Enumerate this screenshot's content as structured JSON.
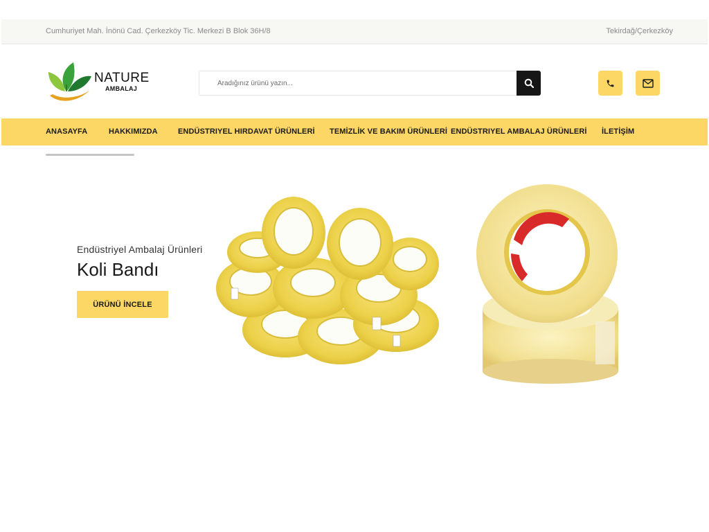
{
  "topbar": {
    "address": "Cumhuriyet Mah. İnönü Cad. Çerkezköy Tic. Merkezi B Blok 36H/8",
    "location": "Tekirdağ/Çerkezköy"
  },
  "logo": {
    "name": "NATURE",
    "subtitle": "AMBALAJ",
    "icon": "leaf-icon"
  },
  "search": {
    "placeholder": "Aradığınız ürünü yazın...",
    "value": "",
    "button_icon": "search-icon"
  },
  "contact": {
    "phone_icon": "phone-icon",
    "mail_icon": "envelope-icon"
  },
  "nav": {
    "items": [
      {
        "label": "ANASAYFA"
      },
      {
        "label": "HAKKIMIZDA"
      },
      {
        "label": "ENDÜSTRIYEL HIRDAVAT ÜRÜNLERİ"
      },
      {
        "label": "TEMİZLİK VE BAKIM ÜRÜNLERİ"
      },
      {
        "label": "ENDÜSTRIYEL AMBALAJ ÜRÜNLERİ"
      },
      {
        "label": "İLETİŞİM"
      }
    ]
  },
  "hero": {
    "category": "Endüstriyel Ambalaj Ürünleri",
    "title": "Koli Bandı",
    "button": "ÜRÜNÜ İNCELE",
    "image": "packing-tape-rolls"
  },
  "colors": {
    "accent": "#fcd765",
    "dark": "#161616",
    "topbar_bg": "#f7f7f4"
  }
}
